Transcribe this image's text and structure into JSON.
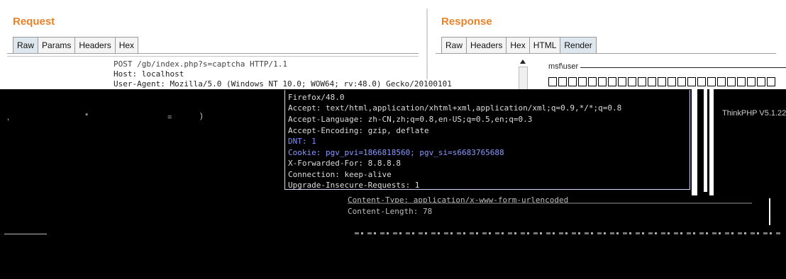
{
  "request": {
    "title": "Request",
    "tabs": [
      "Raw",
      "Params",
      "Headers",
      "Hex"
    ],
    "lines": [
      "POST /gb/index.php?s=captcha HTTP/1.1",
      "Host: localhost",
      "User-Agent: Mozilla/5.0 (Windows NT 10.0; WOW64; rv:48.0) Gecko/20100101"
    ],
    "terminal_lines": [
      "Firefox/48.0",
      "Accept: text/html,application/xhtml+xml,application/xml;q=0.9,*/*;q=0.8",
      "Accept-Language: zh-CN,zh;q=0.8,en-US;q=0.5,en;q=0.3",
      "Accept-Encoding: gzip, deflate",
      "DNT: 1",
      "Cookie: pgv_pvi=1866818560; pgv_si=s6683765688",
      "X-Forwarded-For: 8.8.8.8",
      "Connection: keep-alive",
      "Upgrade-Insecure-Requests: 1"
    ],
    "lower_lines": [
      "Content-Type: application/x-www-form-urlencoded",
      "Content-Length: 78"
    ]
  },
  "response": {
    "title": "Response",
    "tabs": [
      "Raw",
      "Headers",
      "Hex",
      "HTML",
      "Render"
    ],
    "active_tab": "Render",
    "render_text": "msf\\user",
    "right_text": "ThinkPHP V5.1.22"
  },
  "colors": {
    "accent": "#e8832a",
    "terminal_bg": "#000000",
    "terminal_blue": "#7c8bff"
  }
}
